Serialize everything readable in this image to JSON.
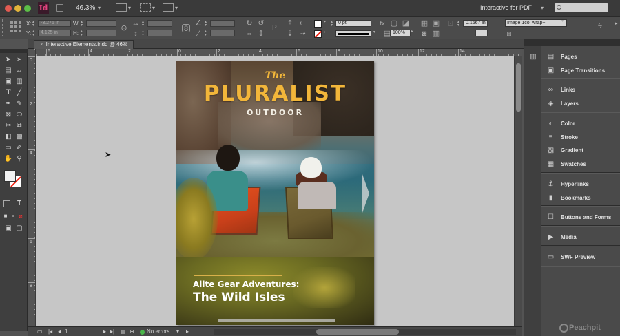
{
  "app": {
    "icon_label": "Id",
    "zoom": "46.3%",
    "workspace": "Interactive for PDF"
  },
  "control": {
    "x_label": "X:",
    "x_value": "-3.275 in",
    "y_label": "Y:",
    "y_value": "4.125 in",
    "w_label": "W:",
    "h_label": "H:",
    "stroke_weight": "0 pt",
    "scale_x": "100%",
    "fitting_value": "0.1667 in",
    "object_style": "Image 1col wrap+"
  },
  "document": {
    "tab_title": "Interactive Elements.indd @ 46%",
    "close_glyph": "×"
  },
  "rulers": {
    "h_labels": [
      "6",
      "4",
      "2",
      "0",
      "2",
      "4",
      "6",
      "8",
      "10",
      "12",
      "14"
    ],
    "v_labels": [
      "0",
      "2",
      "4",
      "6",
      "8"
    ]
  },
  "magazine": {
    "kicker": "The",
    "title": "PLURALIST",
    "subtitle": "OUTDOOR",
    "caption_line1": "Alite Gear Adventures:",
    "caption_line2": "The Wild Isles"
  },
  "status": {
    "page_number": "1",
    "preflight": "No errors"
  },
  "panels": [
    {
      "icon": "pages-icon",
      "label": "Pages"
    },
    {
      "icon": "page-transitions-icon",
      "label": "Page Transitions"
    },
    {
      "icon": "links-icon",
      "label": "Links"
    },
    {
      "icon": "layers-icon",
      "label": "Layers"
    },
    {
      "icon": "color-icon",
      "label": "Color"
    },
    {
      "icon": "stroke-icon",
      "label": "Stroke"
    },
    {
      "icon": "gradient-icon",
      "label": "Gradient"
    },
    {
      "icon": "swatches-icon",
      "label": "Swatches"
    },
    {
      "icon": "hyperlinks-icon",
      "label": "Hyperlinks"
    },
    {
      "icon": "bookmarks-icon",
      "label": "Bookmarks"
    },
    {
      "icon": "buttons-forms-icon",
      "label": "Buttons and Forms"
    },
    {
      "icon": "media-icon",
      "label": "Media"
    },
    {
      "icon": "swf-preview-icon",
      "label": "SWF Preview"
    }
  ],
  "brand": "Peachpit",
  "colors": {
    "accent_title": "#f2b63a",
    "indesign_pink": "#e5437f",
    "pasteboard": "#c6c6c6"
  }
}
